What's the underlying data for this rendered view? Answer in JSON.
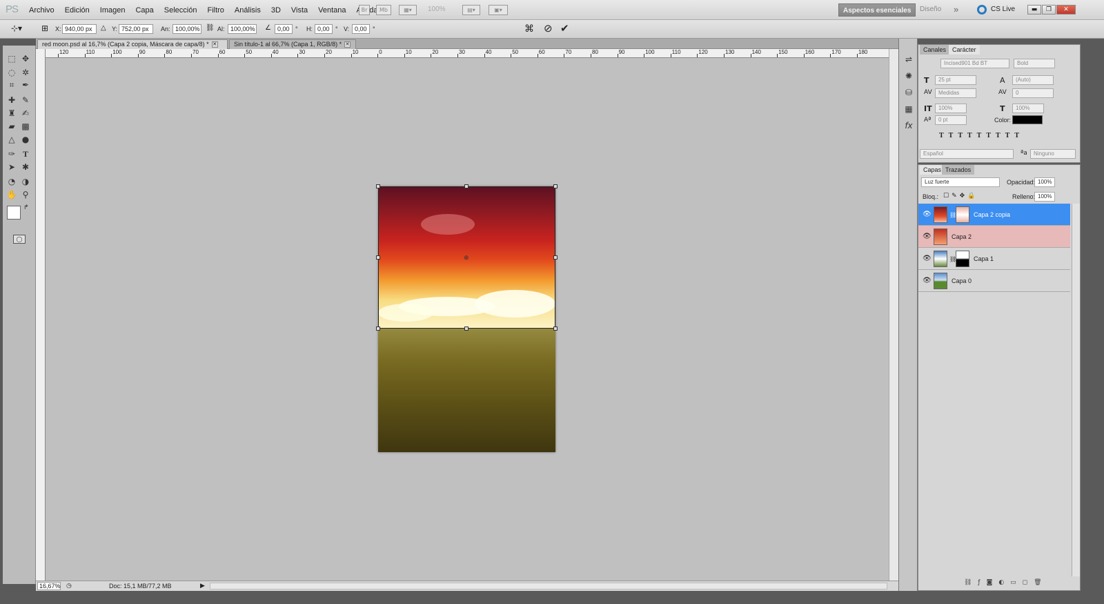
{
  "menubar": {
    "logo": "PS",
    "menus": [
      "Archivo",
      "Edición",
      "Imagen",
      "Capa",
      "Selección",
      "Filtro",
      "Análisis",
      "3D",
      "Vista",
      "Ventana",
      "Ayuda"
    ],
    "zoom": "100%",
    "workspace": "Aspectos esenciales",
    "design": "Diseño",
    "more": "»",
    "cslive": "CS Live"
  },
  "options": {
    "x_label": "X:",
    "x_value": "940,00 px",
    "y_label": "Y:",
    "y_value": "752,00 px",
    "w_label": "An:",
    "w_value": "100,00%",
    "h_label": "Al:",
    "h_value": "100,00%",
    "angle_value": "0,00",
    "deg": "°",
    "hskew_label": "H:",
    "hskew_value": "0,00",
    "vskew_label": "V:",
    "vskew_value": "0,00"
  },
  "tabs": [
    {
      "label": "red moon.psd al 16,7% (Capa 2 copia, Máscara de capa/8) *"
    },
    {
      "label": "Sin título-1 al 66,7% (Capa 1, RGB/8) *"
    }
  ],
  "ruler": {
    "labels": [
      "120",
      "110",
      "100",
      "90",
      "80",
      "70",
      "60",
      "50",
      "40",
      "30",
      "20",
      "10",
      "0",
      "10",
      "20",
      "30",
      "40",
      "50",
      "60",
      "70",
      "80",
      "90",
      "100",
      "110",
      "120",
      "130",
      "140",
      "150",
      "160",
      "170",
      "180"
    ]
  },
  "status": {
    "zoom": "16,67%",
    "doc": "Doc: 15,1 MB/77,2 MB"
  },
  "character": {
    "tabs": [
      "Canales",
      "Carácter"
    ],
    "font_family": "Incised901 Bd BT",
    "font_style": "Bold",
    "size": "25 pt",
    "leading": "(Auto)",
    "kerning": "Medidas",
    "tracking": "0",
    "vscale": "100%",
    "hscale": "100%",
    "baseline": "0 pt",
    "color_label": "Color:",
    "color": "#000000",
    "language": "Español",
    "aa_label": "ªa",
    "antialias": "Ninguno"
  },
  "layers": {
    "tabs": [
      "Capas",
      "Trazados"
    ],
    "blend_mode": "Luz fuerte",
    "opacity_label": "Opacidad:",
    "opacity": "100%",
    "lock_label": "Bloq.:",
    "fill_label": "Relleno:",
    "fill": "100%",
    "items": [
      {
        "name": "Capa 2 copia",
        "selected": true
      },
      {
        "name": "Capa 2",
        "selected": false
      },
      {
        "name": "Capa 1",
        "selected": false
      },
      {
        "name": "Capa 0",
        "selected": false
      }
    ],
    "footer_icons": [
      "link-icon",
      "fx-icon",
      "mask-icon",
      "adjustment-icon",
      "group-icon",
      "new-layer-icon",
      "trash-icon"
    ]
  }
}
